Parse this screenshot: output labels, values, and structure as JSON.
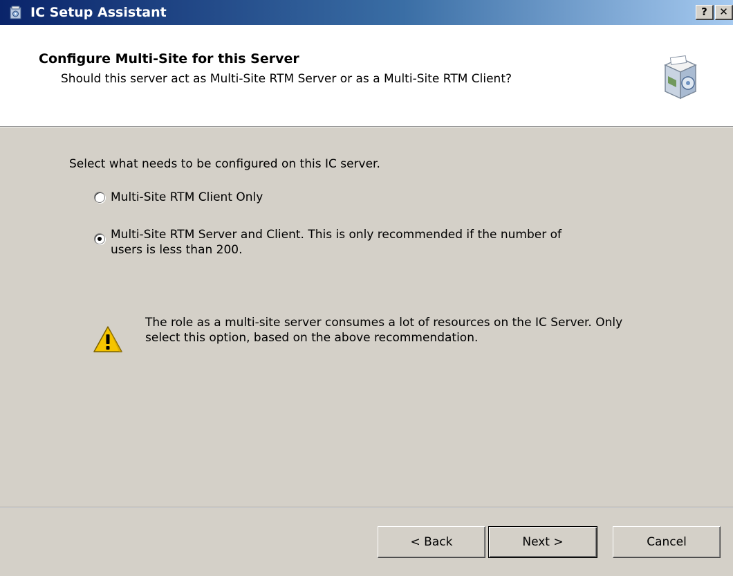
{
  "window": {
    "title": "IC Setup Assistant",
    "help_glyph": "?",
    "close_glyph": "✕",
    "title_icon": "setup-box-icon"
  },
  "header": {
    "title": "Configure Multi-Site for this Server",
    "subtitle": "Should this server act as Multi-Site RTM Server or as a Multi-Site RTM Client?",
    "icon": "setup-box-icon"
  },
  "body": {
    "instruction": "Select what needs to be configured on this IC server.",
    "options": [
      {
        "label": "Multi-Site RTM Client Only",
        "selected": false
      },
      {
        "label": "Multi-Site RTM Server and Client. This is only recommended if the number of users is less than 200.",
        "selected": true
      }
    ],
    "warning": {
      "icon": "warning-icon",
      "text": "The role as a multi-site server consumes a lot of resources on the IC Server. Only select this option, based on the above recommendation."
    }
  },
  "buttons": {
    "back": "< Back",
    "next": "Next >",
    "cancel": "Cancel"
  },
  "colors": {
    "titlebar_start": "#0a246a",
    "titlebar_end": "#a6caf0",
    "dialog_bg": "#d4d0c8",
    "header_bg": "#ffffff",
    "warning_yellow": "#f5c400"
  }
}
